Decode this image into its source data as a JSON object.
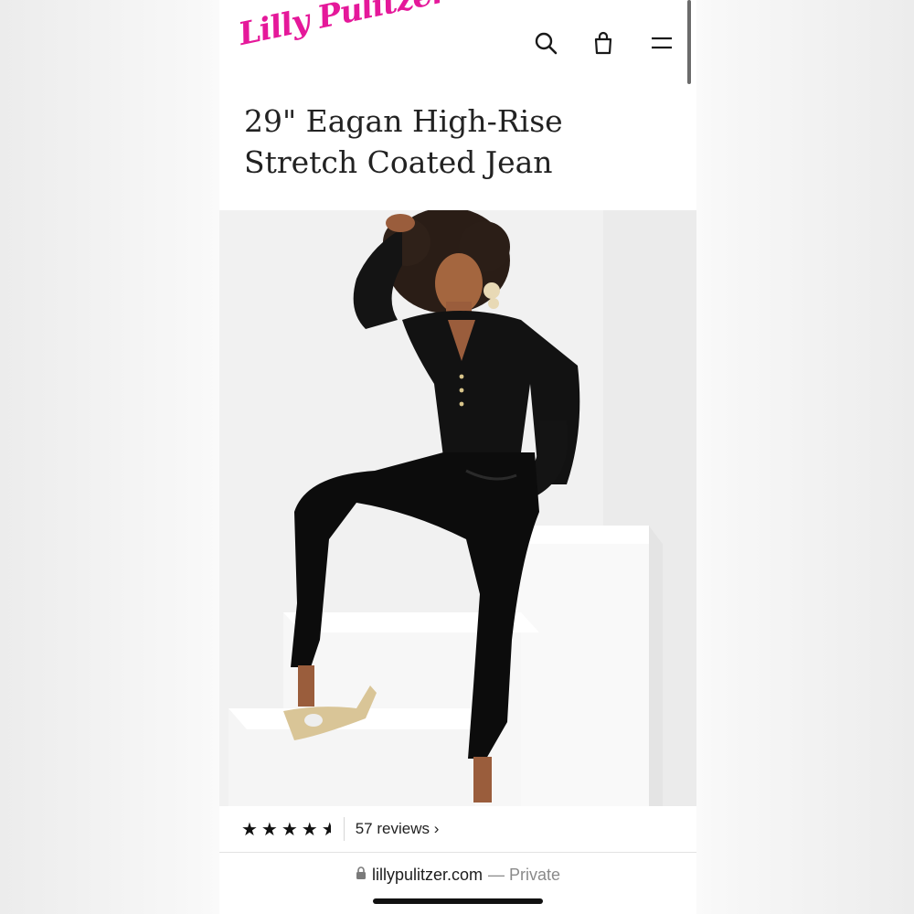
{
  "brand": {
    "logo_text": "Lilly Pulitzer",
    "color": "#e5189a"
  },
  "header": {
    "icons": [
      "search-icon",
      "shopping-bag-icon",
      "menu-icon"
    ]
  },
  "product": {
    "title": "29\" Eagan High-Rise Stretch Coated Jean",
    "image_alt": "Model in black blouse and black coated jeans sitting on white steps",
    "rating": 4.5,
    "stars_full": "★★★★",
    "reviews_label": "57 reviews ›"
  },
  "browser": {
    "domain": "lillypulitzer.com",
    "mode": "— Private",
    "lock_icon": "lock-icon"
  }
}
